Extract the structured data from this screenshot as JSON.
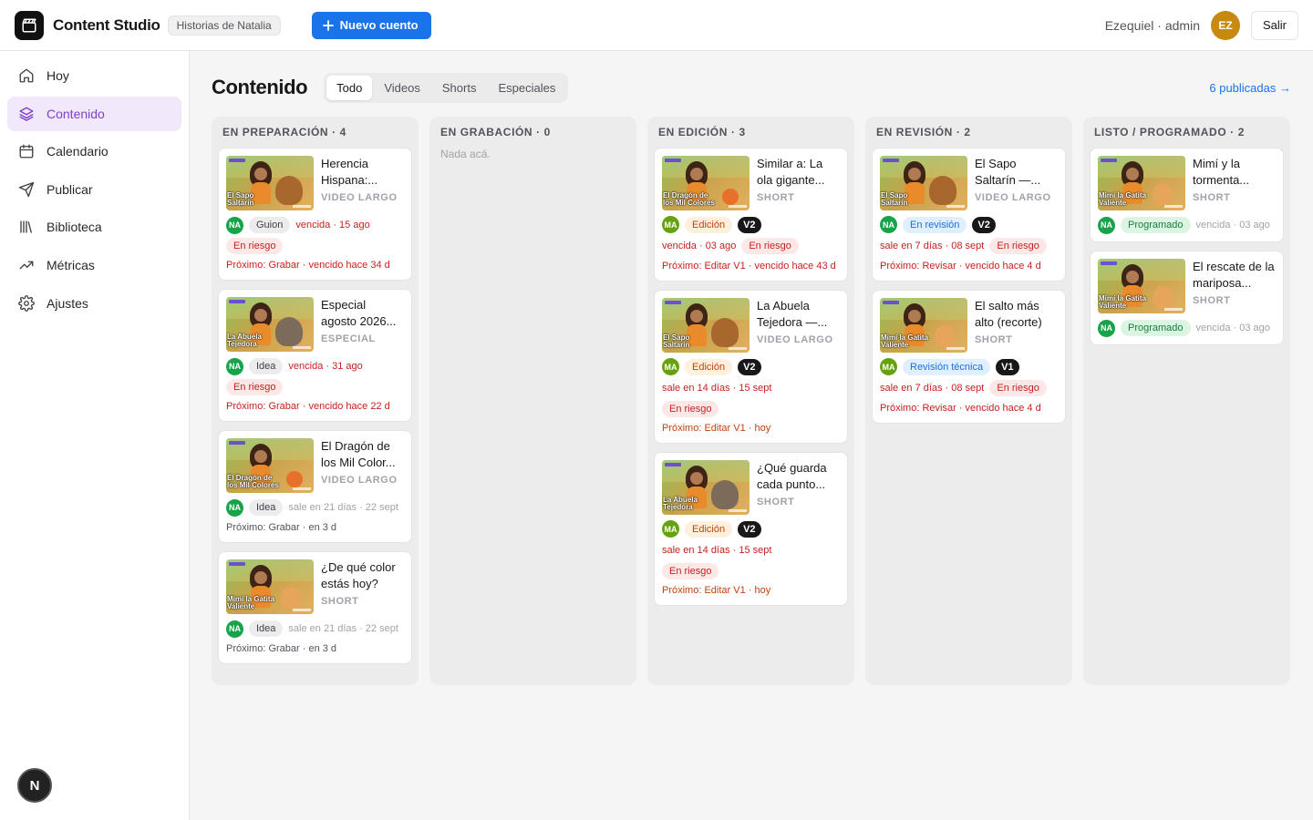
{
  "app": {
    "title": "Content Studio",
    "workspace": "Historias de Natalia",
    "new_button": "Nuevo cuento"
  },
  "user": {
    "label": "Ezequiel · admin",
    "initials": "EZ",
    "logout": "Salir"
  },
  "nav": [
    {
      "label": "Hoy",
      "icon": "home-icon"
    },
    {
      "label": "Contenido",
      "icon": "layers-icon",
      "active": true
    },
    {
      "label": "Calendario",
      "icon": "calendar-icon"
    },
    {
      "label": "Publicar",
      "icon": "send-icon"
    },
    {
      "label": "Biblioteca",
      "icon": "library-icon"
    },
    {
      "label": "Métricas",
      "icon": "trend-icon"
    },
    {
      "label": "Ajustes",
      "icon": "gear-icon"
    }
  ],
  "floating_badge": "N",
  "main": {
    "title": "Contenido",
    "tabs": [
      "Todo",
      "Videos",
      "Shorts",
      "Especiales"
    ],
    "active_tab": "Todo",
    "published_link": "6 publicadas →"
  },
  "columns": [
    {
      "title": "EN PREPARACIÓN · 4",
      "empty": "",
      "cards": [
        {
          "title": "Herencia Hispana:...",
          "type": "VIDEO LARGO",
          "thumb_caption": "El Sapo Saltarín",
          "friend": "bear",
          "avatar": "NA",
          "status": "Guion",
          "status_style": "gray",
          "version": "",
          "meta": "vencida · 15 ago",
          "meta_style": "red",
          "risk": "En riesgo",
          "next": "Próximo: Grabar · vencido hace 34 d",
          "next_style": "red"
        },
        {
          "title": "Especial agosto 2026...",
          "type": "ESPECIAL",
          "thumb_caption": "La Abuela Tejedora",
          "friend": "donkey",
          "avatar": "NA",
          "status": "Idea",
          "status_style": "gray",
          "version": "",
          "meta": "vencida · 31 ago",
          "meta_style": "red",
          "risk": "En riesgo",
          "next": "Próximo: Grabar · vencido hace 22 d",
          "next_style": "red"
        },
        {
          "title": "El Dragón de los Mil Color...",
          "type": "VIDEO LARGO",
          "thumb_caption": "El Dragón de los Mil Colores",
          "friend": "ball",
          "avatar": "NA",
          "status": "Idea",
          "status_style": "gray",
          "version": "",
          "meta": "sale en 21 días · 22 sept",
          "meta_style": "muted",
          "risk": "",
          "next": "Próximo: Grabar · en 3 d",
          "next_style": "gray"
        },
        {
          "title": "¿De qué color estás hoy?",
          "type": "SHORT",
          "thumb_caption": "Mimí la Gatita Valiente",
          "friend": "cat",
          "avatar": "NA",
          "status": "Idea",
          "status_style": "gray",
          "version": "",
          "meta": "sale en 21 días · 22 sept",
          "meta_style": "muted",
          "risk": "",
          "next": "Próximo: Grabar · en 3 d",
          "next_style": "gray"
        }
      ]
    },
    {
      "title": "EN GRABACIÓN · 0",
      "empty": "Nada acá.",
      "cards": []
    },
    {
      "title": "EN EDICIÓN · 3",
      "empty": "",
      "cards": [
        {
          "title": "Similar a: La ola gigante...",
          "type": "SHORT",
          "thumb_caption": "El Dragón de los Mil Colores",
          "friend": "ball",
          "avatar": "MA",
          "status": "Edición",
          "status_style": "orange",
          "version": "V2",
          "meta": "vencida · 03 ago",
          "meta_style": "red",
          "risk": "En riesgo",
          "risk_inline": true,
          "next": "Próximo: Editar V1 · vencido hace 43 d",
          "next_style": "red"
        },
        {
          "title": "La Abuela Tejedora —...",
          "type": "VIDEO LARGO",
          "thumb_caption": "El Sapo Saltarín",
          "friend": "bear",
          "avatar": "MA",
          "status": "Edición",
          "status_style": "orange",
          "version": "V2",
          "meta": "sale en 14 días · 15 sept",
          "meta_style": "red",
          "risk": "En riesgo",
          "next": "Próximo: Editar V1 · hoy",
          "next_style": "orange"
        },
        {
          "title": "¿Qué guarda cada punto...",
          "type": "SHORT",
          "thumb_caption": "La Abuela Tejedora",
          "friend": "donkey",
          "avatar": "MA",
          "status": "Edición",
          "status_style": "orange",
          "version": "V2",
          "meta": "sale en 14 días · 15 sept",
          "meta_style": "red",
          "risk": "En riesgo",
          "next": "Próximo: Editar V1 · hoy",
          "next_style": "orange"
        }
      ]
    },
    {
      "title": "EN REVISIÓN · 2",
      "empty": "",
      "cards": [
        {
          "title": "El Sapo Saltarín —...",
          "type": "VIDEO LARGO",
          "thumb_caption": "El Sapo Saltarín",
          "friend": "bear",
          "avatar": "NA",
          "status": "En revisión",
          "status_style": "blue",
          "version": "V2",
          "meta": "sale en 7 días · 08 sept",
          "meta_style": "red",
          "risk": "En riesgo",
          "risk_inline": true,
          "next": "Próximo: Revisar · vencido hace 4 d",
          "next_style": "red"
        },
        {
          "title": "El salto más alto (recorte)",
          "type": "SHORT",
          "thumb_caption": "Mimí la Gatita Valiente",
          "friend": "cat",
          "avatar": "MA",
          "status": "Revisión técnica",
          "status_style": "blue",
          "version": "V1",
          "meta": "sale en 7 días · 08 sept",
          "meta_style": "red",
          "risk": "En riesgo",
          "risk_inline": true,
          "next": "Próximo: Revisar · vencido hace 4 d",
          "next_style": "red"
        }
      ]
    },
    {
      "title": "LISTO / PROGRAMADO · 2",
      "empty": "",
      "cards": [
        {
          "title": "Mimí y la tormenta...",
          "type": "SHORT",
          "thumb_caption": "Mimí la Gatita Valiente",
          "friend": "cat",
          "avatar": "NA",
          "status": "Programado",
          "status_style": "green",
          "version": "",
          "meta": "vencida · 03 ago",
          "meta_style": "muted",
          "risk": "",
          "next": "",
          "next_style": "gray"
        },
        {
          "title": "El rescate de la mariposa...",
          "type": "SHORT",
          "thumb_caption": "Mimí la Gatita Valiente",
          "friend": "cat",
          "avatar": "NA",
          "status": "Programado",
          "status_style": "green",
          "version": "",
          "meta": "vencida · 03 ago",
          "meta_style": "muted",
          "risk": "",
          "next": "",
          "next_style": "gray"
        }
      ]
    }
  ]
}
